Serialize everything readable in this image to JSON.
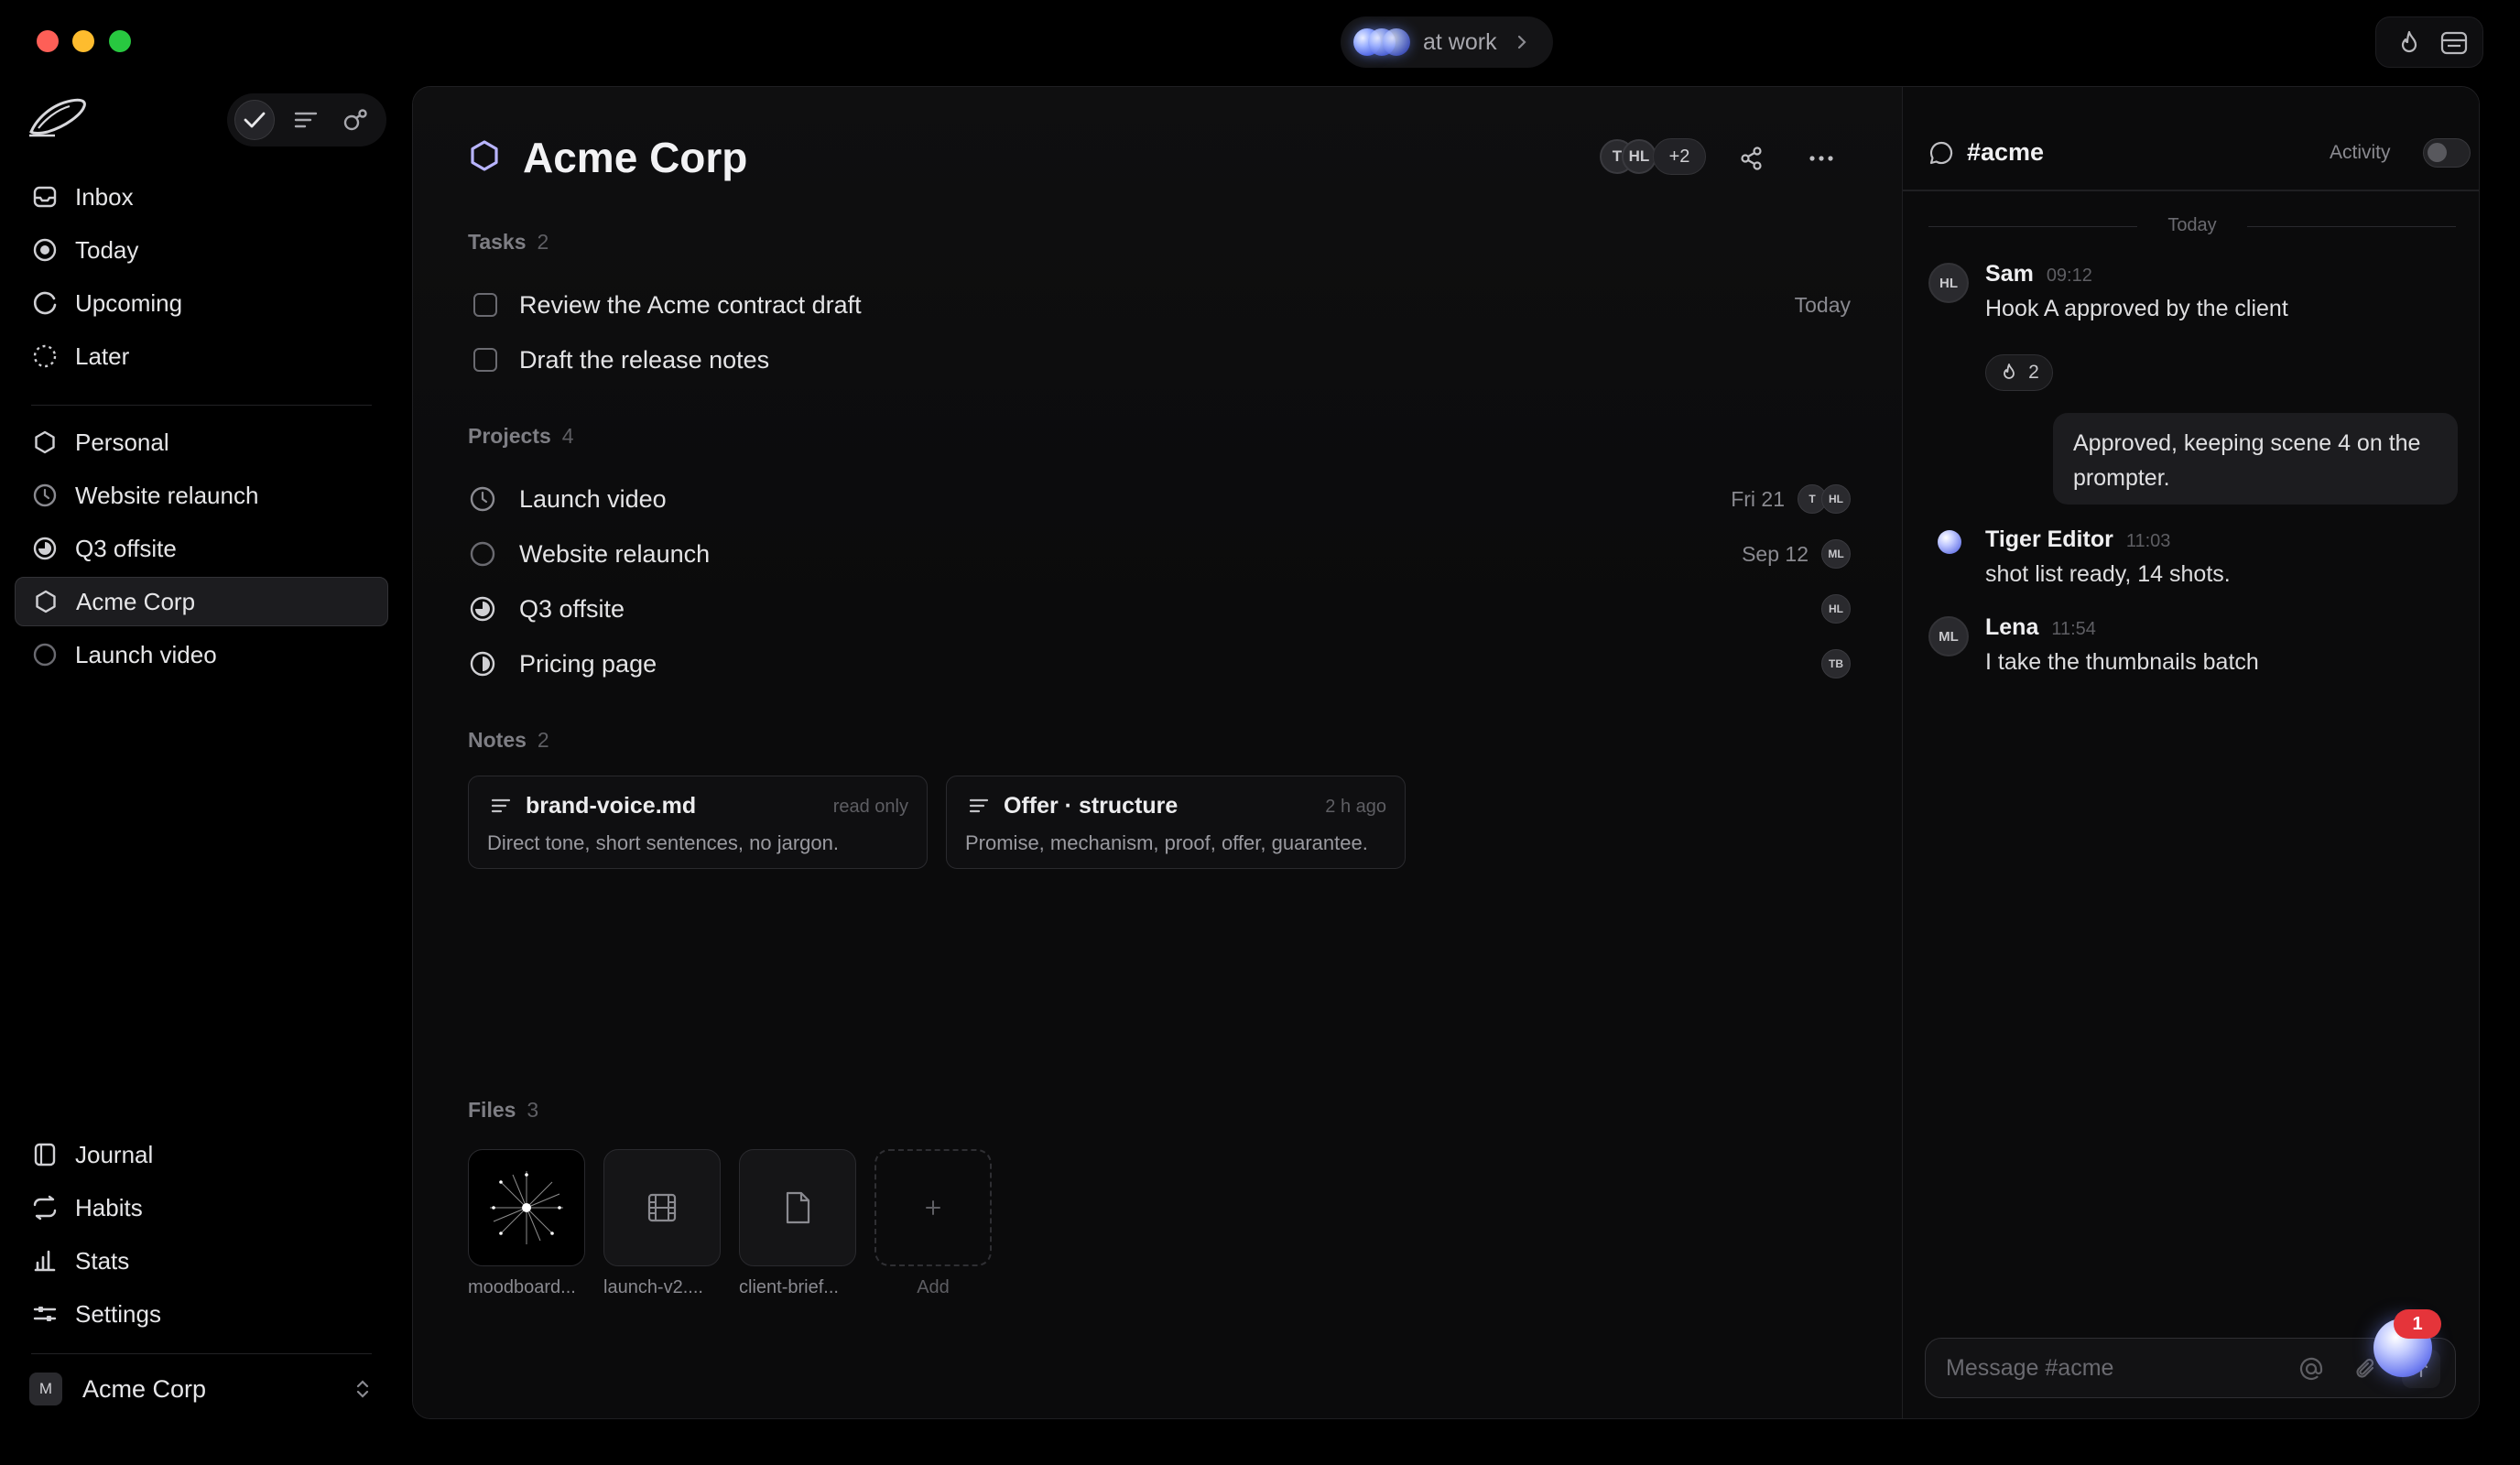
{
  "status": {
    "label": "at work"
  },
  "sidebar": {
    "nav": [
      {
        "label": "Inbox",
        "icon": "inbox-icon"
      },
      {
        "label": "Today",
        "icon": "today-icon"
      },
      {
        "label": "Upcoming",
        "icon": "upcoming-icon"
      },
      {
        "label": "Later",
        "icon": "later-icon"
      }
    ],
    "projects": [
      {
        "label": "Personal",
        "icon": "hexagon-icon"
      },
      {
        "label": "Website relaunch",
        "icon": "clock-icon"
      },
      {
        "label": "Q3 offsite",
        "icon": "progress-ring-icon"
      },
      {
        "label": "Acme Corp",
        "icon": "hexagon-icon",
        "active": true
      },
      {
        "label": "Launch video",
        "icon": "empty-circle-icon"
      }
    ],
    "bottom": [
      {
        "label": "Journal",
        "icon": "journal-icon"
      },
      {
        "label": "Habits",
        "icon": "habits-icon"
      },
      {
        "label": "Stats",
        "icon": "stats-icon"
      },
      {
        "label": "Settings",
        "icon": "settings-icon"
      }
    ],
    "workspace": {
      "badge": "M",
      "name": "Acme Corp"
    }
  },
  "header": {
    "title": "Acme Corp",
    "avatars": [
      "T",
      "HL"
    ],
    "more_count": "+2"
  },
  "tasks": {
    "label": "Tasks",
    "count": "2",
    "items": [
      {
        "title": "Review the Acme contract draft",
        "meta": "Today"
      },
      {
        "title": "Draft the release notes",
        "meta": ""
      }
    ]
  },
  "projects": {
    "label": "Projects",
    "count": "4",
    "items": [
      {
        "title": "Launch video",
        "date": "Fri 21",
        "avatars": [
          "T",
          "HL"
        ]
      },
      {
        "title": "Website relaunch",
        "date": "Sep 12",
        "avatars": [
          "ML"
        ]
      },
      {
        "title": "Q3 offsite",
        "date": "",
        "avatars": [
          "HL"
        ]
      },
      {
        "title": "Pricing page",
        "date": "",
        "avatars": [
          "TB"
        ]
      }
    ]
  },
  "notes": {
    "label": "Notes",
    "count": "2",
    "items": [
      {
        "title": "brand-voice.md",
        "meta": "read only",
        "desc": "Direct tone, short sentences, no jargon."
      },
      {
        "title": "Offer · structure",
        "meta": "2 h ago",
        "desc": "Promise, mechanism, proof, offer, guarantee."
      }
    ]
  },
  "files": {
    "label": "Files",
    "count": "3",
    "items": [
      {
        "name": "moodboard...",
        "icon": "sparkle-image-icon"
      },
      {
        "name": "launch-v2....",
        "icon": "film-icon"
      },
      {
        "name": "client-brief...",
        "icon": "document-icon"
      }
    ],
    "add_label": "Add"
  },
  "chat": {
    "channel": "#acme",
    "activity_label": "Activity",
    "day_label": "Today",
    "messages": [
      {
        "avatar": "HL",
        "name": "Sam",
        "time": "09:12",
        "text": "Hook A approved by the client"
      },
      {
        "avatar": "",
        "name": "Tiger Editor",
        "time": "11:03",
        "text": "shot list ready, 14 shots."
      },
      {
        "avatar": "ML",
        "name": "Lena",
        "time": "11:54",
        "text": "I take the thumbnails batch"
      }
    ],
    "reaction_count": "2",
    "own_message": "Approved, keeping scene 4 on the prompter.",
    "composer_placeholder": "Message #acme"
  },
  "notification_count": "1"
}
